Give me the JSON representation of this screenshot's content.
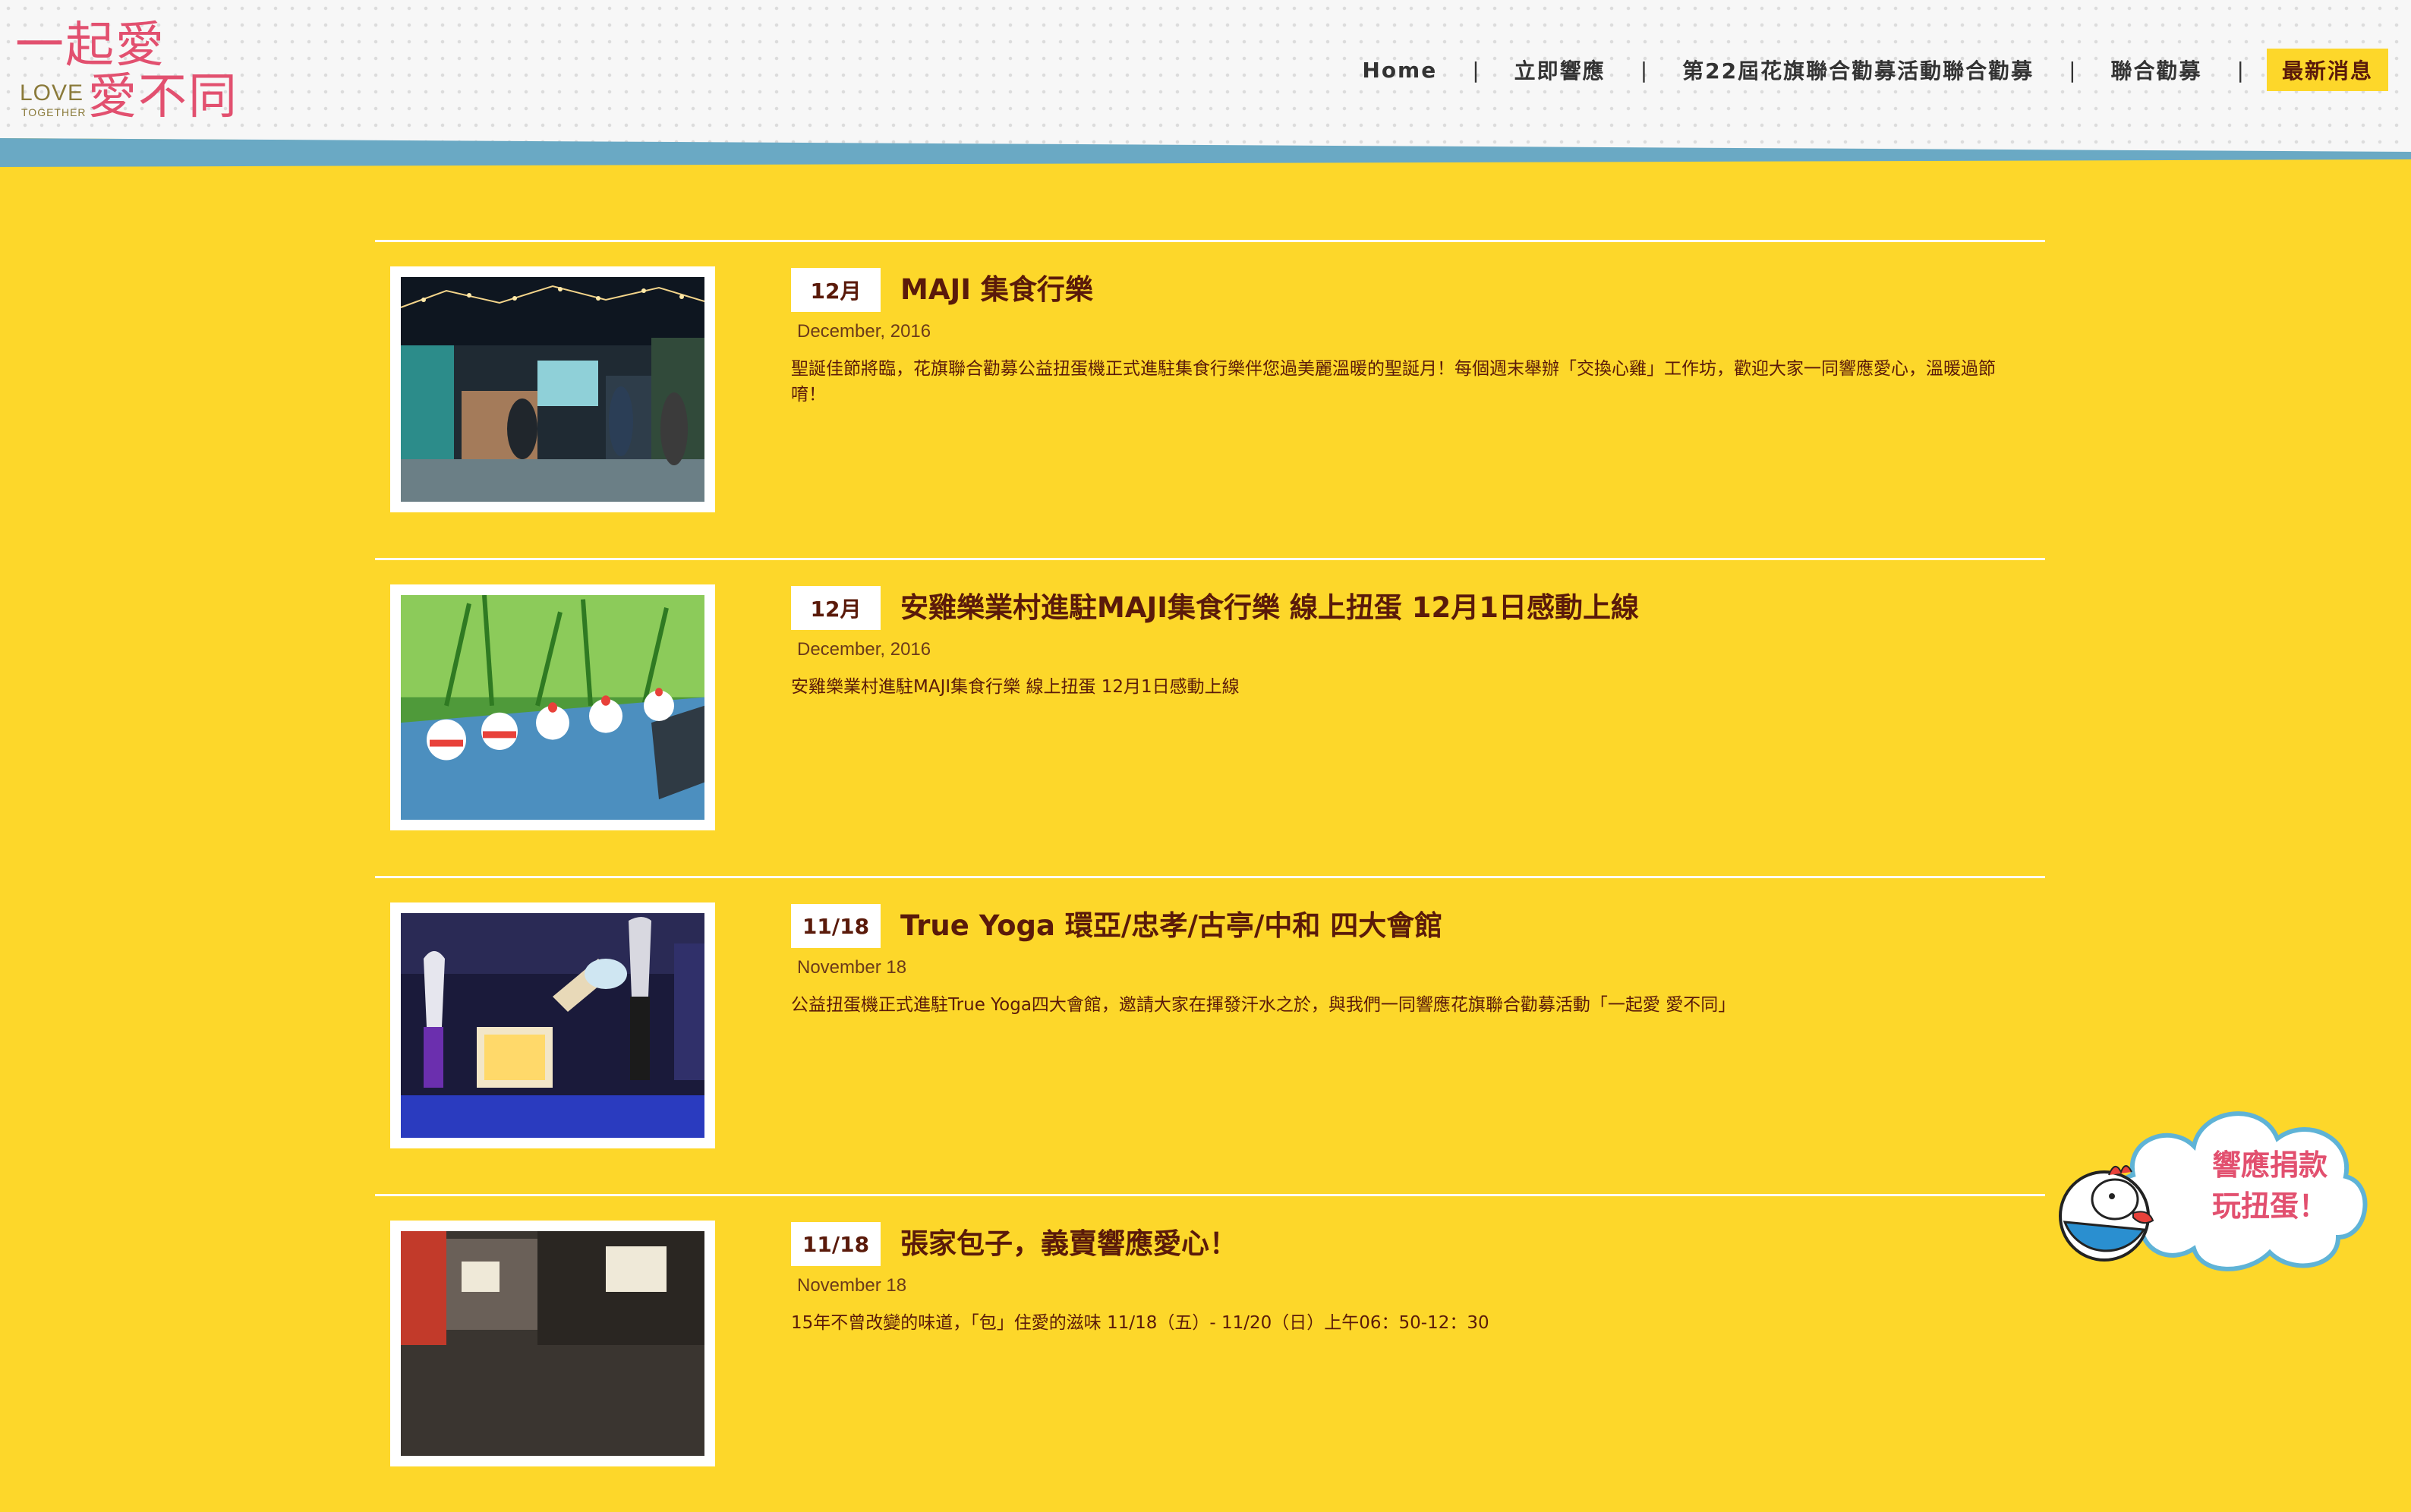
{
  "header": {
    "logo": {
      "line1": "一起愛",
      "line2": "愛不同",
      "love": "LOVE",
      "together": "TOGETHER"
    },
    "nav": [
      {
        "label": "Home"
      },
      {
        "label": "立即響應"
      },
      {
        "label": "第22屆花旗聯合勸募活動聯合勸募"
      },
      {
        "label": "聯合勸募"
      },
      {
        "label": "最新消息",
        "active": true
      }
    ],
    "separator": "|"
  },
  "posts": [
    {
      "badge": "12月",
      "title": "MAJI 集食行樂",
      "date": "December, 2016",
      "desc": "聖誕佳節將臨，花旗聯合勸募公益扭蛋機正式進駐集食行樂伴您過美麗溫暖的聖誕月！每個週末舉辦「交換心雞」工作坊，歡迎大家一同響應愛心，溫暖過節唷！"
    },
    {
      "badge": "12月",
      "title": "安雞樂業村進駐MAJI集食行樂 線上扭蛋 12月1日感動上線",
      "date": "December, 2016",
      "desc": "安雞樂業村進駐MAJI集食行樂 線上扭蛋 12月1日感動上線"
    },
    {
      "badge": "11/18",
      "title": "True Yoga 環亞/忠孝/古亭/中和 四大會館",
      "date": "November 18",
      "desc": "公益扭蛋機正式進駐True Yoga四大會館，邀請大家在揮發汗水之於，與我們一同響應花旗聯合勸募活動「一起愛 愛不同」"
    },
    {
      "badge": "11/18",
      "title": "張家包子，義賣響應愛心！",
      "date": "November 18",
      "desc": "15年不曾改變的味道，「包」住愛的滋味 11/18（五）- 11/20（日）上午06：50-12：30"
    }
  ],
  "float_badge": {
    "line1": "響應捐款",
    "line2": "玩扭蛋！"
  },
  "colors": {
    "background": "#FDD72A",
    "logo_pink": "#e2506f",
    "title_brown": "#5a1a0a",
    "band_blue": "#6aa9c4"
  }
}
